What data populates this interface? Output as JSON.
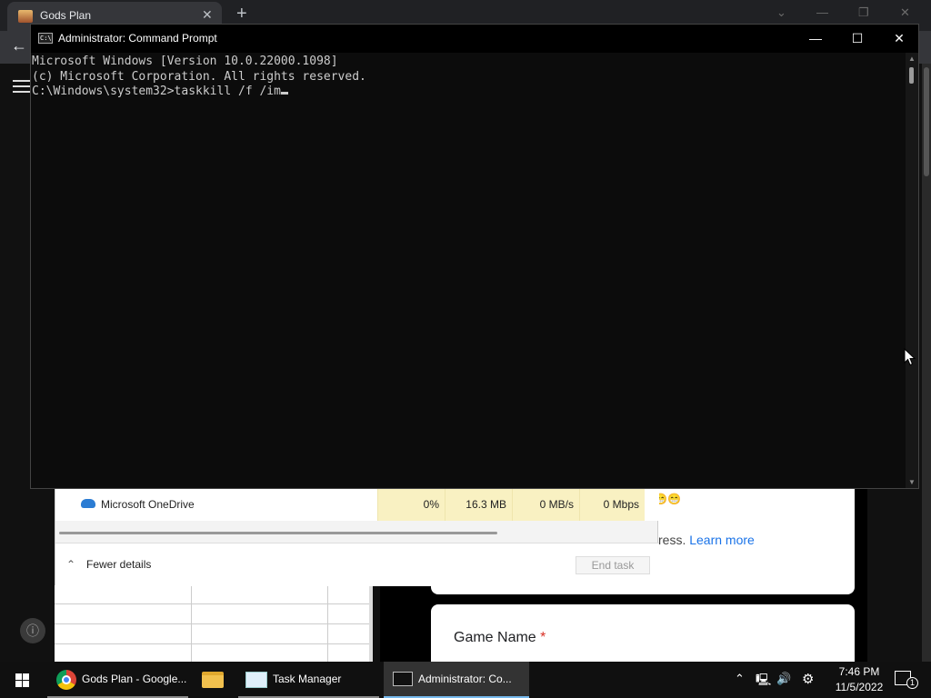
{
  "browser": {
    "tab_title": "Gods Plan",
    "tab_close": "✕",
    "new_tab": "+",
    "back": "←"
  },
  "form": {
    "emoji": "😁😁",
    "notice_suffix": "ress.",
    "learn_more": "Learn more",
    "question_label": "Game Name",
    "required_mark": "*"
  },
  "task_manager": {
    "process": {
      "name": "Microsoft OneDrive",
      "cpu": "0%",
      "memory": "16.3 MB",
      "disk": "0 MB/s",
      "network": "0 Mbps"
    },
    "fewer_details": "Fewer details",
    "end_task": "End task"
  },
  "cmd": {
    "title": "Administrator: Command Prompt",
    "icon_text": "C:\\",
    "lines": [
      "Microsoft Windows [Version 10.0.22000.1098]",
      "(c) Microsoft Corporation. All rights reserved."
    ],
    "prompt": "C:\\Windows\\system32>",
    "input": "taskkill /f /im"
  },
  "taskbar": {
    "apps": [
      {
        "label": "Gods Plan - Google...",
        "icon": "chrome-icon"
      },
      {
        "label": "",
        "icon": "file-explorer-icon"
      },
      {
        "label": "Task Manager",
        "icon": "task-manager-icon"
      },
      {
        "label": "Administrator: Co...",
        "icon": "command-prompt-icon"
      }
    ],
    "clock_time": "7:46 PM",
    "clock_date": "11/5/2022",
    "notification_count": "1"
  },
  "colors": {
    "cmd_bg": "#0c0c0c",
    "cmd_text": "#cccccc",
    "taskbar_bg": "#101010",
    "accent": "#76b9ed",
    "link": "#1a73e8",
    "required": "#d93025"
  }
}
